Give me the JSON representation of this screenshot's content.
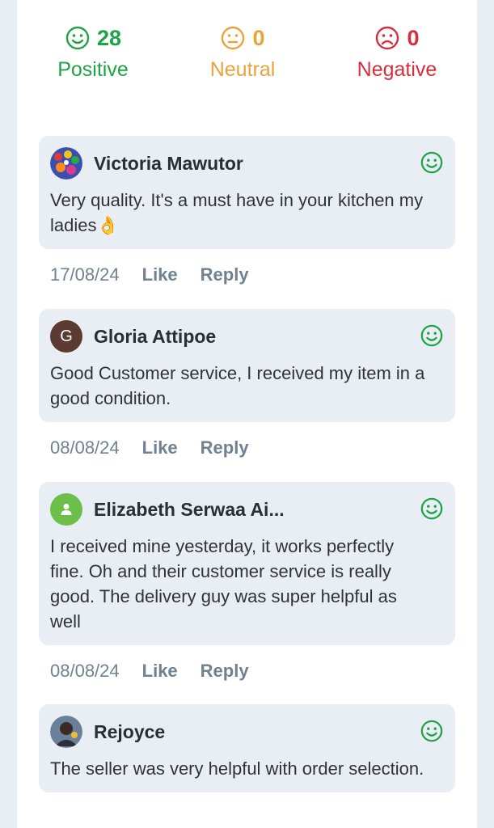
{
  "colors": {
    "positive": "#1fa347",
    "neutral": "#e8a33a",
    "negative": "#d62f3c",
    "card_bg": "#e9eef5",
    "meta_text": "#6f8192"
  },
  "summary": {
    "positive": {
      "count": "28",
      "label": "Positive",
      "icon": "happy-face-icon"
    },
    "neutral": {
      "count": "0",
      "label": "Neutral",
      "icon": "neutral-face-icon"
    },
    "negative": {
      "count": "0",
      "label": "Negative",
      "icon": "sad-face-icon"
    }
  },
  "comments": [
    {
      "author": "Victoria Mawutor",
      "avatar": "photo",
      "text": "Very quality.  It's a must have  in your kitchen my ladies👌",
      "date": "17/08/24",
      "like_label": "Like",
      "reply_label": "Reply",
      "sentiment": "positive"
    },
    {
      "author": "Gloria Attipoe",
      "avatar": "G",
      "avatar_color": "#5b3a31",
      "text": "Good Customer service, I received my item in a good condition.",
      "date": "08/08/24",
      "like_label": "Like",
      "reply_label": "Reply",
      "sentiment": "positive"
    },
    {
      "author": "Elizabeth Serwaa Ai...",
      "avatar": "person-icon",
      "avatar_color": "#6cc04a",
      "text": "I received mine yesterday, it works perfectly fine. Oh and their customer service is really good. The delivery guy was super helpful as well",
      "date": "08/08/24",
      "like_label": "Like",
      "reply_label": "Reply",
      "sentiment": "positive"
    },
    {
      "author": "Rejoyce",
      "avatar": "photo",
      "text": "The seller was very helpful with order selection.",
      "sentiment": "positive"
    }
  ]
}
